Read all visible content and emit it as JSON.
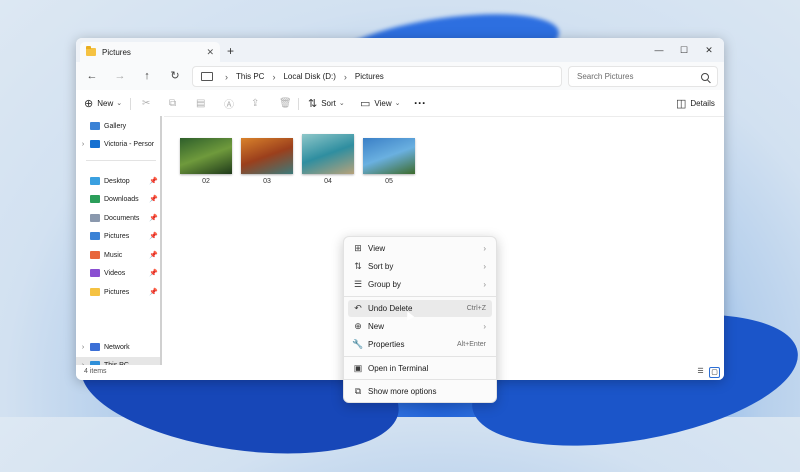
{
  "window": {
    "tab_title": "Pictures"
  },
  "address": {
    "crumbs": [
      "This PC",
      "Local Disk (D:)",
      "Pictures"
    ]
  },
  "search": {
    "placeholder": "Search Pictures"
  },
  "toolbar": {
    "new_label": "New",
    "sort_label": "Sort",
    "view_label": "View",
    "details_label": "Details"
  },
  "sidebar": {
    "items": [
      {
        "label": "Gallery",
        "icon": "gallery-icon",
        "color": "#3b82d6"
      },
      {
        "label": "Victoria - Persor",
        "icon": "cloud-icon",
        "color": "#1570d1"
      },
      {
        "label": "Desktop",
        "icon": "desktop-icon",
        "color": "#3aa0e0"
      },
      {
        "label": "Downloads",
        "icon": "download-icon",
        "color": "#2b9e5a"
      },
      {
        "label": "Documents",
        "icon": "document-icon",
        "color": "#8a98ad"
      },
      {
        "label": "Pictures",
        "icon": "pictures-icon",
        "color": "#3b82d6"
      },
      {
        "label": "Music",
        "icon": "music-icon",
        "color": "#e8663c"
      },
      {
        "label": "Videos",
        "icon": "videos-icon",
        "color": "#8a4fd1"
      },
      {
        "label": "Pictures",
        "icon": "folder-icon",
        "color": "#f5c242"
      },
      {
        "label": "This PC",
        "icon": "pc-icon",
        "color": "#2f8fd8"
      },
      {
        "label": "Network",
        "icon": "network-icon",
        "color": "#3b6fd6"
      }
    ]
  },
  "files": [
    {
      "name": "02",
      "colors": [
        "#2e5f2b",
        "#6f9a3c",
        "#1f3a1a"
      ]
    },
    {
      "name": "03",
      "colors": [
        "#d9822b",
        "#9b3f1c",
        "#3c7a7a"
      ]
    },
    {
      "name": "04",
      "colors": [
        "#8ec7c9",
        "#2f8ea0",
        "#b7a27a"
      ]
    },
    {
      "name": "05",
      "colors": [
        "#3a7fc6",
        "#6ab0e0",
        "#3d6b2c"
      ]
    }
  ],
  "status": {
    "item_count": "4 items"
  },
  "context_menu": {
    "items": [
      {
        "label": "View",
        "icon": "grid-icon",
        "submenu": true
      },
      {
        "label": "Sort by",
        "icon": "sort-icon",
        "submenu": true
      },
      {
        "label": "Group by",
        "icon": "group-icon",
        "submenu": true
      },
      {
        "label": "Undo Delete",
        "icon": "undo-icon",
        "shortcut": "Ctrl+Z"
      },
      {
        "label": "New",
        "icon": "new-icon",
        "submenu": true
      },
      {
        "label": "Properties",
        "icon": "properties-icon",
        "shortcut": "Alt+Enter"
      },
      {
        "label": "Open in Terminal",
        "icon": "terminal-icon"
      },
      {
        "label": "Show more options",
        "icon": "more-options-icon"
      }
    ]
  }
}
